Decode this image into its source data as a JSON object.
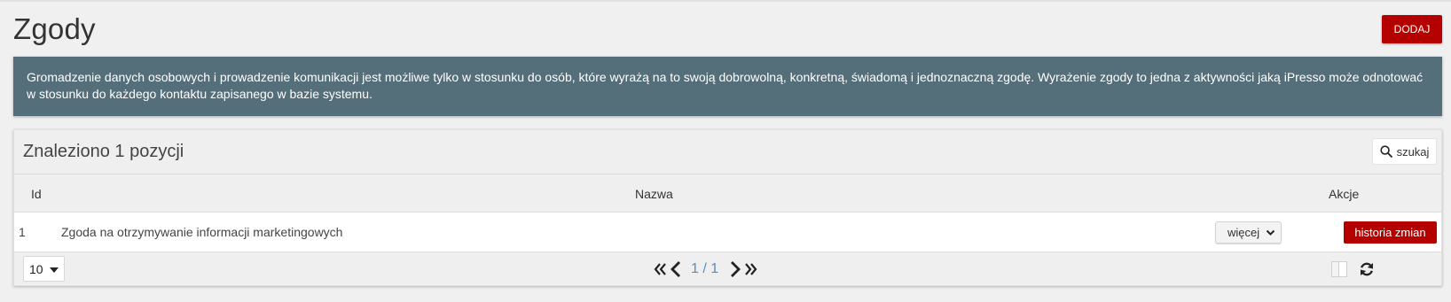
{
  "header": {
    "title": "Zgody",
    "add_label": "DODAJ"
  },
  "info": {
    "text": "Gromadzenie danych osobowych i prowadzenie komunikacji jest możliwe tylko w stosunku do osób, które wyrażą na to swoją dobrowolną, konkretną, świadomą i jednoznaczną zgodę. Wyrażenie zgody to jedna z aktywności jaką iPresso może odnotować w stosunku do każdego kontaktu zapisanego w bazie systemu."
  },
  "list": {
    "count_label": "Znaleziono 1 pozycji",
    "search_label": "szukaj",
    "columns": {
      "id": "Id",
      "name": "Nazwa",
      "actions": "Akcje"
    },
    "rows": [
      {
        "id": "1",
        "name": "Zgoda na otrzymywanie informacji marketingowych",
        "more_label": "więcej",
        "history_label": "historia zmian"
      }
    ]
  },
  "footer": {
    "page_size": "10",
    "pager_label": "1 / 1"
  },
  "colors": {
    "accent": "#b50000",
    "info_bg": "#546e7a",
    "pager_text": "#5b8cc0"
  },
  "icons": [
    "search-icon",
    "chevron-down-icon",
    "caret-down-icon",
    "first-page-icon",
    "prev-page-icon",
    "next-page-icon",
    "last-page-icon",
    "columns-toggle-icon",
    "refresh-icon"
  ]
}
